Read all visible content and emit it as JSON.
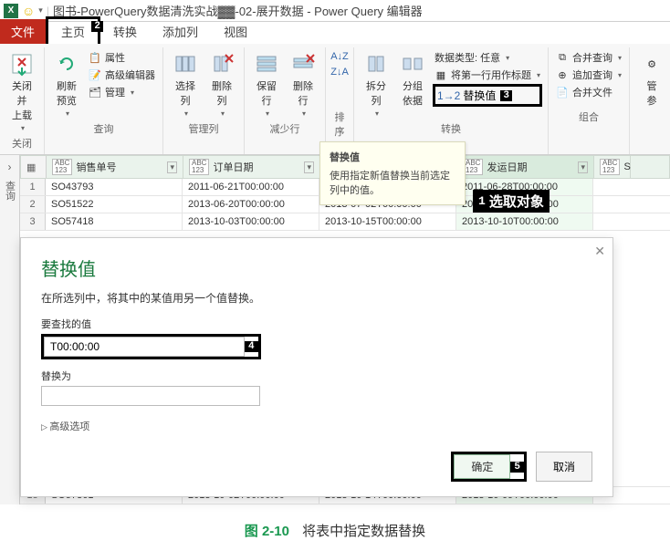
{
  "titlebar": {
    "title": "图书-PowerQuery数据清洗实战▓▓-02-展开数据 - Power Query 编辑器"
  },
  "tabs": {
    "file": "文件",
    "home": "主页",
    "transform": "转换",
    "addcol": "添加列",
    "view": "视图",
    "home_marker": "2"
  },
  "ribbon": {
    "close_load": "关闭并\n上载",
    "close_grp": "关闭",
    "refresh": "刷新\n预览",
    "props": "属性",
    "adv_editor": "高级编辑器",
    "manage": "管理",
    "query_grp": "查询",
    "choose_col": "选择\n列",
    "remove_col": "删除\n列",
    "mgmt_col_grp": "管理列",
    "keep_row": "保留\n行",
    "remove_row": "删除\n行",
    "reduce_row_grp": "减少行",
    "sort_grp": "排序",
    "split_col": "拆分\n列",
    "group_by": "分组\n依据",
    "datatype": "数据类型: 任意",
    "first_row_header": "将第一行用作标题",
    "replace": "替换值",
    "replace_marker": "3",
    "transform_grp": "转换",
    "merge_q": "合并查询",
    "append_q": "追加查询",
    "merge_files": "合并文件",
    "combine_grp": "组合",
    "manage2": "管\n参"
  },
  "tooltip": {
    "title": "替换值",
    "body": "使用指定新值替换当前选定列中的值。"
  },
  "callout1": {
    "num": "1",
    "text": "选取对象"
  },
  "grid": {
    "headers": {
      "sales": "销售单号",
      "order_date": "订单日期",
      "ship_date": "发运日期",
      "last": "S",
      "tag": "ABC\n123"
    },
    "rows": [
      {
        "n": "1",
        "sales": "SO43793",
        "d1": "2011-06-21T00:00:00",
        "d2": "",
        "d3": "2011-06-28T00:00:00"
      },
      {
        "n": "2",
        "sales": "SO51522",
        "d1": "2013-06-20T00:00:00",
        "d2": "2013-07-02T00:00:00",
        "d3": "2013-06-27T00:00:00"
      },
      {
        "n": "3",
        "sales": "SO57418",
        "d1": "2013-10-03T00:00:00",
        "d2": "2013-10-15T00:00:00",
        "d3": "2013-10-10T00:00:00"
      }
    ],
    "row18": {
      "n": "18",
      "sales": "SO57361",
      "d1": "2013-10-02T00:00:00",
      "d2": "2013-10-14T00:00:00",
      "d3": "2013-10-09T00:00:00"
    },
    "vtext": "查询"
  },
  "dialog": {
    "title": "替换值",
    "desc": "在所选列中，将其中的某值用另一个值替换。",
    "find_label": "要查找的值",
    "find_value": "T00:00:00",
    "find_marker": "4",
    "replace_label": "替换为",
    "replace_value": "",
    "advanced": "高级选项",
    "ok": "确定",
    "ok_marker": "5",
    "cancel": "取消"
  },
  "caption": {
    "fignum": "图 2-10",
    "text": "将表中指定数据替换"
  }
}
